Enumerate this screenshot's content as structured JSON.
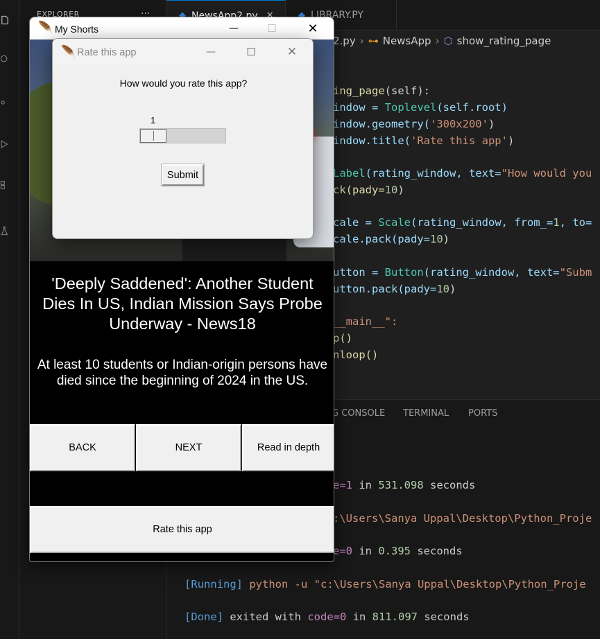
{
  "vscode": {
    "sidebar_title": "EXPLORER",
    "sidebar_more": "···",
    "tabs": [
      {
        "label": "NewsApp2.py",
        "active": true
      },
      {
        "label": "LIBRARY.PY",
        "active": false
      }
    ],
    "breadcrumb": {
      "file": "2.py",
      "class": "NewsApp",
      "method": "show_rating_page"
    },
    "code": [
      [
        "ing_page",
        "(self):"
      ],
      [
        "indow = ",
        "Toplevel",
        "(self.root)"
      ],
      [
        "indow.geometry(",
        "'300x200'",
        ")"
      ],
      [
        "indow.title(",
        "'Rate this app'",
        ")"
      ],
      [
        "Label",
        "(rating_window, text=",
        "\"How would you"
      ],
      [
        "ck(pady=",
        "10",
        ")"
      ],
      [
        "cale = ",
        "Scale",
        "(rating_window, from_=",
        "1",
        ", to="
      ],
      [
        "cale.pack(pady=",
        "10",
        ")"
      ],
      [
        "utton = ",
        "Button",
        "(rating_window, text=",
        "\"Subm"
      ],
      [
        "utton.pack(pady=",
        "10",
        ")"
      ],
      [
        "__main__\":"
      ],
      [
        "p()"
      ],
      [
        "nloop()"
      ]
    ],
    "panel_tabs": [
      "G CONSOLE",
      "TERMINAL",
      "PORTS"
    ],
    "terminal": [
      {
        "prefix": "e=1",
        "mid": " in ",
        "num": "531.098",
        "suffix": " seconds"
      },
      {
        "prefix": "",
        "mid": ":\\Users\\Sanya Uppal\\Desktop\\Python_Proje",
        "num": "",
        "suffix": ""
      },
      {
        "prefix": "e=0",
        "mid": " in ",
        "num": "0.395",
        "suffix": " seconds"
      },
      {
        "prefix": "[Running]",
        "mid": " python -u \"c:\\Users\\Sanya Uppal\\Desktop\\Python_Proje",
        "num": "",
        "suffix": ""
      },
      {
        "prefix": "[Done]",
        "mid": " exited with ",
        "code": "code=0",
        "mid2": " in ",
        "num": "811.097",
        "suffix": " seconds"
      }
    ]
  },
  "my_shorts": {
    "title": "My Shorts",
    "headline": "'Deeply Saddened': Another Student Dies In US, Indian Mission Says Probe Underway - News18",
    "summary": "At least 10 students or Indian-origin persons have died since the beginning of 2024 in the US.",
    "back_label": "BACK",
    "next_label": "NEXT",
    "read_label": "Read in depth",
    "rate_label": "Rate this app"
  },
  "rate_dialog": {
    "title": "Rate this app",
    "question": "How would you rate this app?",
    "scale_value": "1",
    "scale_level_fraction": 0,
    "submit_label": "Submit"
  },
  "colors": {
    "vscode_bg": "#1f1f1f",
    "tk_button": "#f0f0f0",
    "headline_bg": "#000000"
  }
}
